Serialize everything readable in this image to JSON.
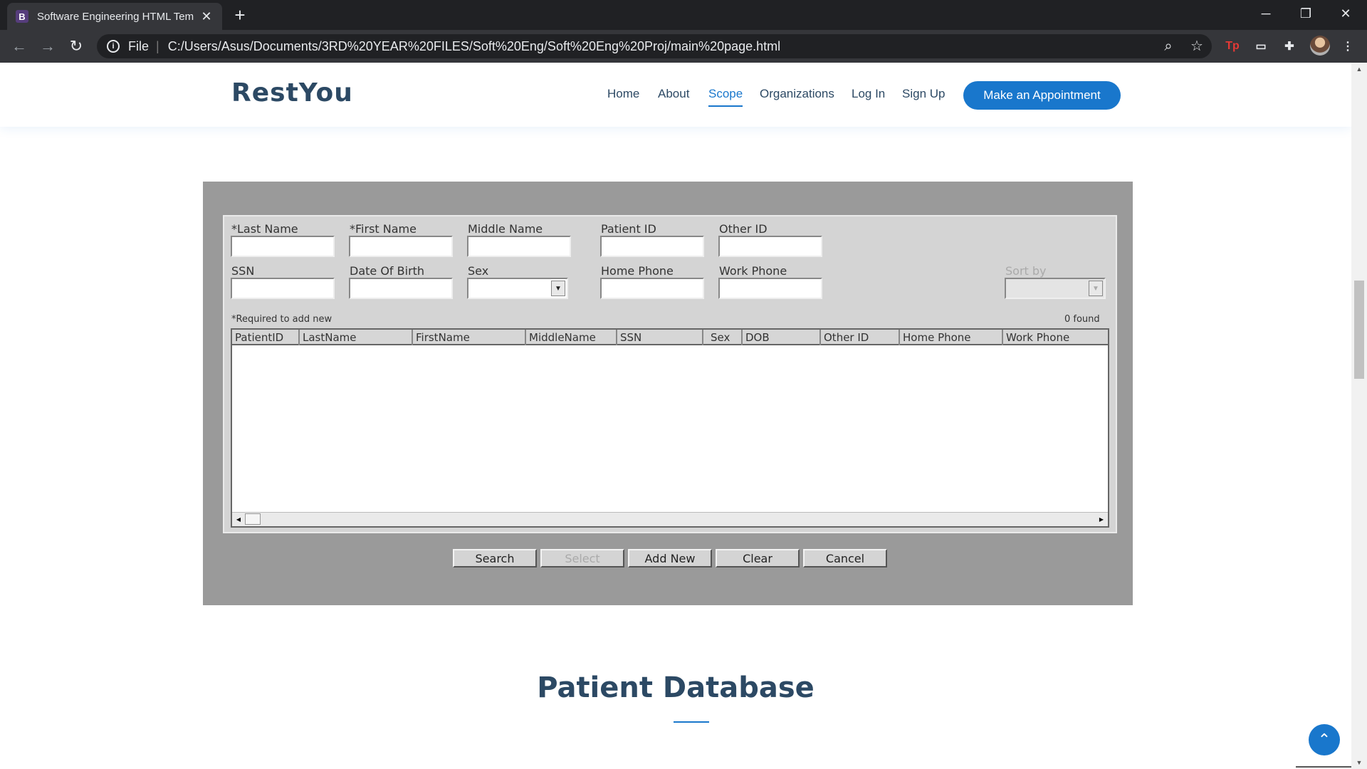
{
  "browser": {
    "tab_title": "Software Engineering HTML Tem",
    "tab_favicon": "B",
    "new_tab": "+",
    "omnibox_scheme": "File",
    "omnibox_url": "C:/Users/Asus/Documents/3RD%20YEAR%20FILES/Soft%20Eng/Soft%20Eng%20Proj/main%20page.html",
    "ext_tp": "Tp"
  },
  "site": {
    "logo": "RestYou",
    "nav": [
      {
        "label": "Home"
      },
      {
        "label": "About"
      },
      {
        "label": "Scope",
        "active": true
      },
      {
        "label": "Organizations"
      },
      {
        "label": "Log In"
      },
      {
        "label": "Sign Up"
      }
    ],
    "cta": "Make an Appointment"
  },
  "patient_form": {
    "labels": {
      "last_name": "*Last Name",
      "first_name": "*First Name",
      "middle_name": "Middle Name",
      "patient_id": "Patient ID",
      "other_id": "Other ID",
      "ssn": "SSN",
      "dob": "Date Of Birth",
      "sex": "Sex",
      "home_phone": "Home Phone",
      "work_phone": "Work Phone",
      "sort_by": "Sort by"
    },
    "required_note": "*Required to add new",
    "found": "0 found",
    "columns": [
      "PatientID",
      "LastName",
      "FirstName",
      "MiddleName",
      "SSN",
      "Sex",
      "DOB",
      "Other ID",
      "Home Phone",
      "Work Phone"
    ],
    "buttons": {
      "search": "Search",
      "select": "Select",
      "add_new": "Add New",
      "clear": "Clear",
      "cancel": "Cancel"
    }
  },
  "section": {
    "title": "Patient Database"
  }
}
